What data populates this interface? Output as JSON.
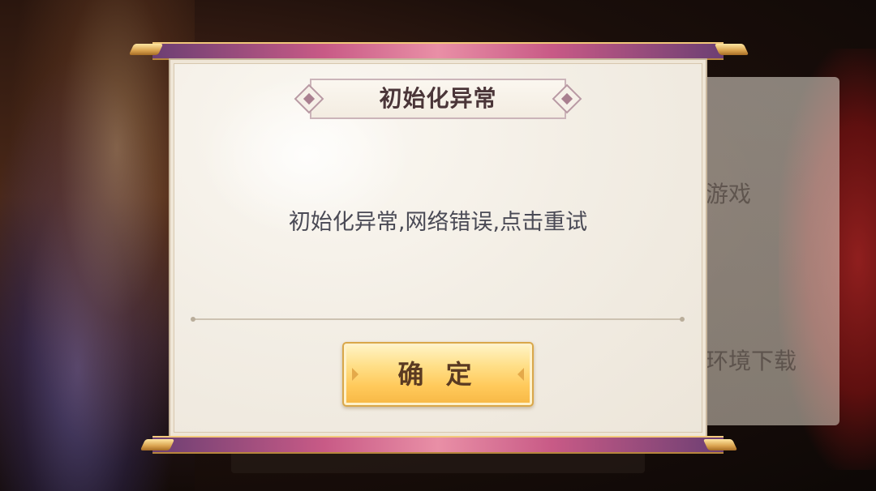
{
  "background": {
    "text_right_top": "游戏",
    "text_right_bottom": "环境下载"
  },
  "dialog": {
    "title": "初始化异常",
    "message": "初始化异常,网络错误,点击重试",
    "confirm_label": "确 定"
  },
  "colors": {
    "rod_accent": "#c85a86",
    "button_gold": "#ffc95a",
    "title_text": "#4a3538",
    "message_text": "#4a4a55"
  }
}
